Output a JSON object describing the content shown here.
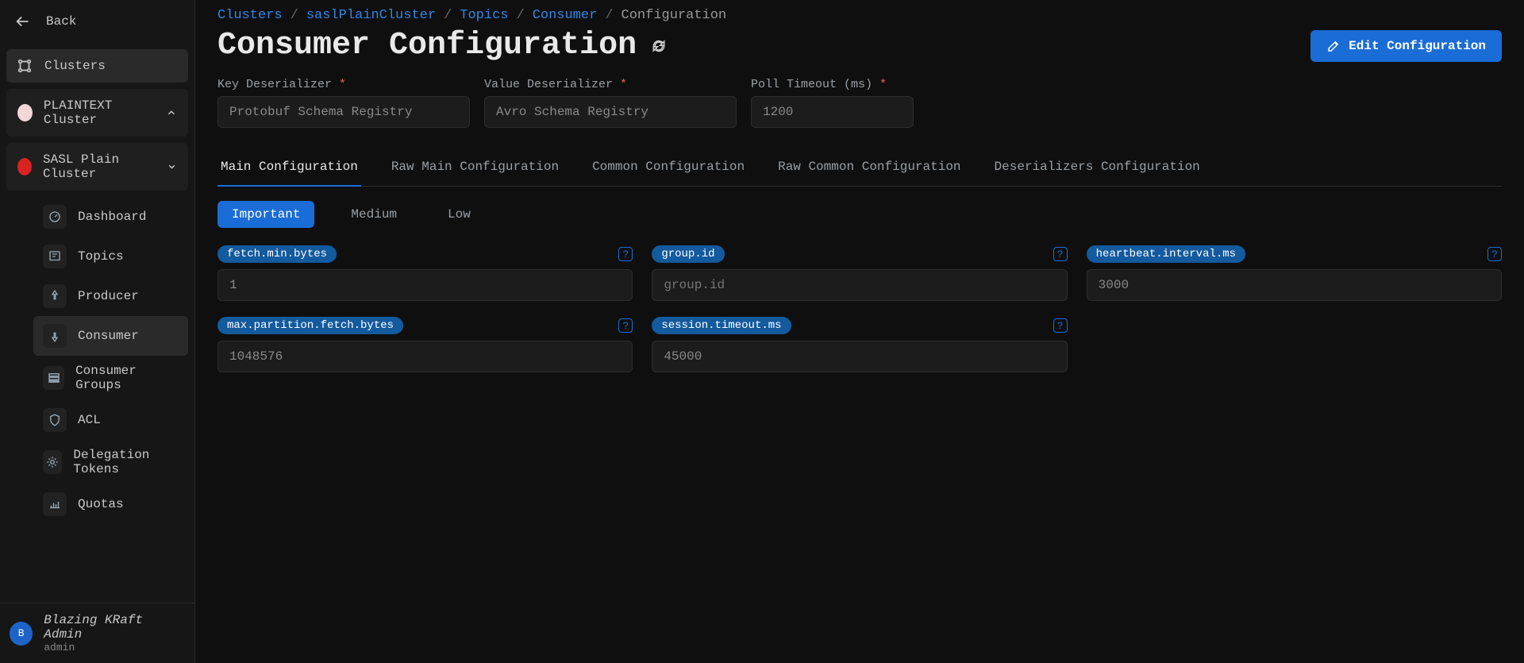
{
  "back_label": "Back",
  "sidebar": {
    "clusters_label": "Clusters",
    "cluster1": {
      "name": "PLAINTEXT Cluster"
    },
    "cluster2": {
      "name": "SASL Plain Cluster"
    },
    "nav": {
      "dashboard": "Dashboard",
      "topics": "Topics",
      "producer": "Producer",
      "consumer": "Consumer",
      "consumer_groups": "Consumer Groups",
      "acl": "ACL",
      "delegation_tokens": "Delegation Tokens",
      "quotas": "Quotas"
    }
  },
  "footer": {
    "avatar_letter": "B",
    "user_name": "Blazing KRaft Admin",
    "user_role": "admin"
  },
  "breadcrumb": {
    "clusters": "Clusters",
    "cluster": "saslPlainCluster",
    "topics": "Topics",
    "consumer": "Consumer",
    "configuration": "Configuration"
  },
  "page_title": "Consumer Configuration",
  "edit_button": "Edit Configuration",
  "fields": {
    "key_deser": {
      "label": "Key Deserializer",
      "value": "Protobuf Schema Registry"
    },
    "value_deser": {
      "label": "Value Deserializer",
      "value": "Avro Schema Registry"
    },
    "poll_timeout": {
      "label": "Poll Timeout (ms)",
      "value": "1200"
    }
  },
  "tabs": {
    "main": "Main Configuration",
    "raw_main": "Raw Main Configuration",
    "common": "Common Configuration",
    "raw_common": "Raw Common Configuration",
    "deser": "Deserializers Configuration"
  },
  "filters": {
    "important": "Important",
    "medium": "Medium",
    "low": "Low"
  },
  "configs": {
    "fetch_min_bytes": {
      "key": "fetch.min.bytes",
      "value": "1"
    },
    "group_id": {
      "key": "group.id",
      "placeholder": "group.id"
    },
    "heartbeat": {
      "key": "heartbeat.interval.ms",
      "value": "3000"
    },
    "max_partition": {
      "key": "max.partition.fetch.bytes",
      "value": "1048576"
    },
    "session_timeout": {
      "key": "session.timeout.ms",
      "value": "45000"
    }
  }
}
